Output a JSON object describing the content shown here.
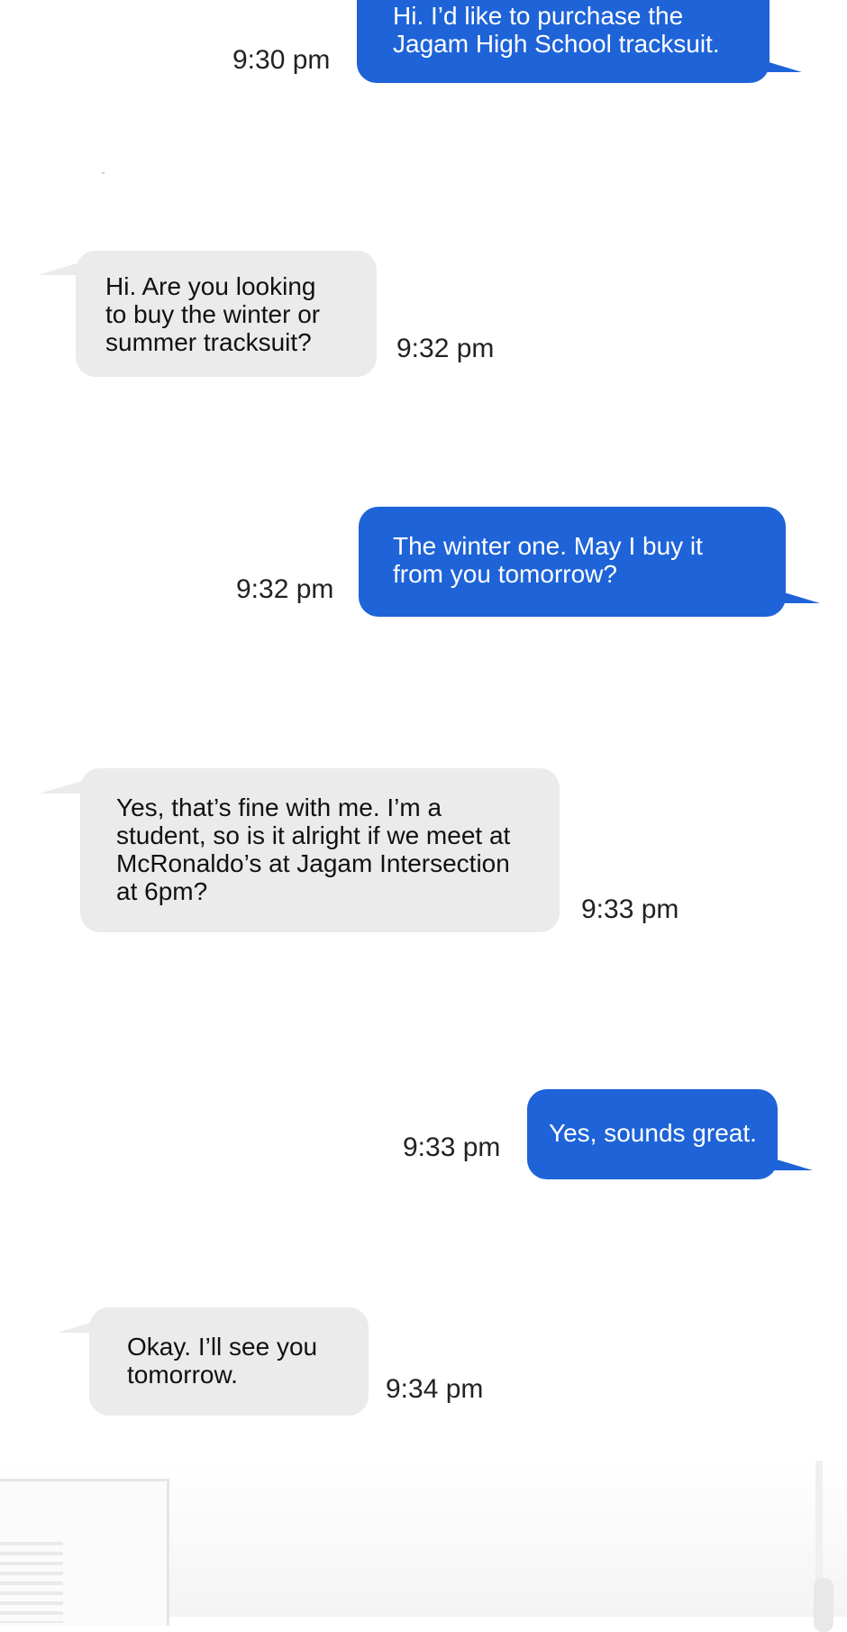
{
  "colors": {
    "sent_bubble": "#1e63d8",
    "received_bubble": "#ebebeb",
    "sent_text": "#ffffff",
    "received_text": "#111111"
  },
  "messages": [
    {
      "sender": "me",
      "text": "Hi. I’d like to purchase the\nJagam High School tracksuit.",
      "time": "9:30 pm"
    },
    {
      "sender": "them",
      "text": "Hi. Are you looking\nto buy the winter or\nsummer tracksuit?",
      "time": "9:32 pm"
    },
    {
      "sender": "me",
      "text": "The winter one. May I buy it\nfrom you tomorrow?",
      "time": "9:32 pm"
    },
    {
      "sender": "them",
      "text": "Yes, that’s fine with me. I’m a\nstudent, so is it alright if we meet at\nMcRonaldo’s at Jagam Intersection\nat 6pm?",
      "time": "9:33 pm"
    },
    {
      "sender": "me",
      "text": "Yes, sounds great.",
      "time": "9:33 pm"
    },
    {
      "sender": "them",
      "text": "Okay. I’ll see you\ntomorrow.",
      "time": "9:34 pm"
    }
  ]
}
